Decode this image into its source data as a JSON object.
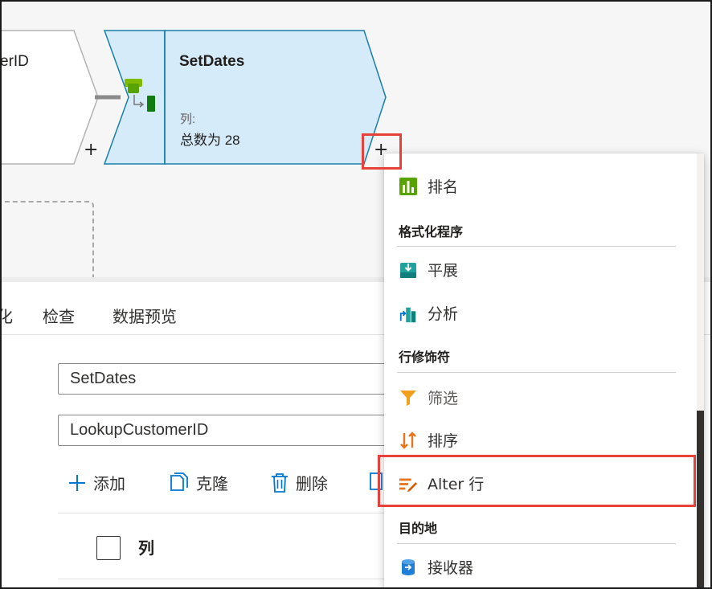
{
  "canvas": {
    "prev_node": {
      "title": "erID",
      "add_label": "+"
    },
    "current_node": {
      "title": "SetDates",
      "subtitle": "列:",
      "count": "总数为 28",
      "add_label": "+"
    }
  },
  "tabs": [
    {
      "label": "化"
    },
    {
      "label": "检查"
    },
    {
      "label": "数据预览"
    }
  ],
  "form": {
    "output_stream_value": "SetDates",
    "incoming_stream_value": "LookupCustomerID"
  },
  "toolbar": {
    "add_label": "添加",
    "clone_label": "克隆",
    "delete_label": "删除"
  },
  "table": {
    "column_header": "列"
  },
  "dropdown": {
    "items": {
      "rank": "排名",
      "flatten": "平展",
      "parse": "分析",
      "filter": "筛选",
      "sort": "排序",
      "alter_row": "Alter 行",
      "sink": "接收器"
    },
    "headers": {
      "formatters": "格式化程序",
      "row_modifiers": "行修饰符",
      "destination": "目的地"
    }
  },
  "colors": {
    "highlight": "#e8413a",
    "node_fill": "#d6ebfa",
    "node_border": "#1a7fa8",
    "accent": "#0078d4"
  }
}
